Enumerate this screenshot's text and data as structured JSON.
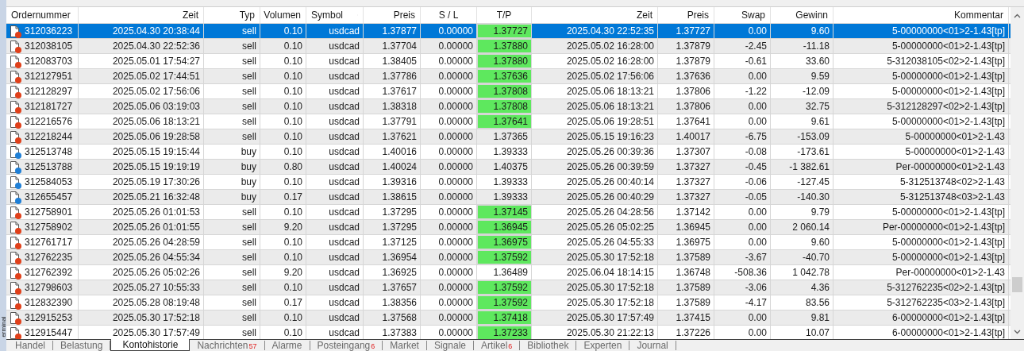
{
  "side_label": "erminal",
  "table": {
    "columns": [
      "Ordernummer",
      "Zeit",
      "Typ",
      "Volumen",
      "Symbol",
      "Preis",
      "S / L",
      "T/P",
      "Zeit",
      "Preis",
      "Swap",
      "Gewinn",
      "Kommentar"
    ],
    "rows": [
      {
        "selected": true,
        "tp_hit": true,
        "color": "#e0401a",
        "cells": [
          "312036223",
          "2025.04.30 20:38:44",
          "sell",
          "0.10",
          "usdcad",
          "1.37877",
          "0.00000",
          "1.37727",
          "2025.04.30 22:52:35",
          "1.37727",
          "0.00",
          "9.60",
          "5-00000000<01>2-1.43[tp]"
        ]
      },
      {
        "selected": false,
        "tp_hit": true,
        "color": "#e0401a",
        "cells": [
          "312038105",
          "2025.04.30 22:52:36",
          "sell",
          "0.10",
          "usdcad",
          "1.37704",
          "0.00000",
          "1.37880",
          "2025.05.02 16:28:00",
          "1.37879",
          "-2.45",
          "-11.18",
          "5-00000000<01>2-1.43[tp]"
        ]
      },
      {
        "selected": false,
        "tp_hit": true,
        "color": "#e0401a",
        "cells": [
          "312083703",
          "2025.05.01 17:54:27",
          "sell",
          "0.10",
          "usdcad",
          "1.38405",
          "0.00000",
          "1.37880",
          "2025.05.02 16:28:00",
          "1.37879",
          "-0.61",
          "33.60",
          "5-312038105<02>2-1.43[tp]"
        ]
      },
      {
        "selected": false,
        "tp_hit": true,
        "color": "#e0401a",
        "cells": [
          "312127951",
          "2025.05.02 17:44:51",
          "sell",
          "0.10",
          "usdcad",
          "1.37786",
          "0.00000",
          "1.37636",
          "2025.05.02 17:56:06",
          "1.37636",
          "0.00",
          "9.59",
          "5-00000000<01>2-1.43[tp]"
        ]
      },
      {
        "selected": false,
        "tp_hit": true,
        "color": "#e0401a",
        "cells": [
          "312128297",
          "2025.05.02 17:56:06",
          "sell",
          "0.10",
          "usdcad",
          "1.37617",
          "0.00000",
          "1.37808",
          "2025.05.06 18:13:21",
          "1.37806",
          "-1.22",
          "-12.09",
          "5-00000000<01>2-1.43[tp]"
        ]
      },
      {
        "selected": false,
        "tp_hit": true,
        "color": "#e0401a",
        "cells": [
          "312181727",
          "2025.05.06 03:19:03",
          "sell",
          "0.10",
          "usdcad",
          "1.38318",
          "0.00000",
          "1.37808",
          "2025.05.06 18:13:21",
          "1.37806",
          "0.00",
          "32.75",
          "5-312128297<02>2-1.43[tp]"
        ]
      },
      {
        "selected": false,
        "tp_hit": true,
        "color": "#e0401a",
        "cells": [
          "312216576",
          "2025.05.06 18:13:21",
          "sell",
          "0.10",
          "usdcad",
          "1.37791",
          "0.00000",
          "1.37641",
          "2025.05.06 19:28:51",
          "1.37641",
          "0.00",
          "9.61",
          "5-00000000<01>2-1.43[tp]"
        ]
      },
      {
        "selected": false,
        "tp_hit": false,
        "color": "#e0401a",
        "cells": [
          "312218244",
          "2025.05.06 19:28:58",
          "sell",
          "0.10",
          "usdcad",
          "1.37621",
          "0.00000",
          "1.37365",
          "2025.05.15 19:16:23",
          "1.40017",
          "-6.75",
          "-153.09",
          "5-00000000<01>2-1.43"
        ]
      },
      {
        "selected": false,
        "tp_hit": false,
        "color": "#1f7fd6",
        "cells": [
          "312513748",
          "2025.05.15 19:15:44",
          "buy",
          "0.10",
          "usdcad",
          "1.40016",
          "0.00000",
          "1.39333",
          "2025.05.26 00:39:36",
          "1.37307",
          "-0.08",
          "-173.61",
          "5-00000000<01>2-1.43"
        ]
      },
      {
        "selected": false,
        "tp_hit": false,
        "color": "#1f7fd6",
        "cells": [
          "312513788",
          "2025.05.15 19:19:19",
          "buy",
          "0.80",
          "usdcad",
          "1.40024",
          "0.00000",
          "1.40375",
          "2025.05.26 00:39:59",
          "1.37327",
          "-0.45",
          "-1 382.61",
          "Per-00000000<01>2-1.43"
        ]
      },
      {
        "selected": false,
        "tp_hit": false,
        "color": "#1f7fd6",
        "cells": [
          "312584053",
          "2025.05.19 17:30:26",
          "buy",
          "0.10",
          "usdcad",
          "1.39316",
          "0.00000",
          "1.39333",
          "2025.05.26 00:40:14",
          "1.37327",
          "-0.06",
          "-127.45",
          "5-312513748<02>2-1.43"
        ]
      },
      {
        "selected": false,
        "tp_hit": false,
        "color": "#1f7fd6",
        "cells": [
          "312655457",
          "2025.05.21 16:32:48",
          "buy",
          "0.17",
          "usdcad",
          "1.38615",
          "0.00000",
          "1.39333",
          "2025.05.26 00:40:29",
          "1.37327",
          "-0.05",
          "-140.30",
          "5-312513748<03>2-1.43"
        ]
      },
      {
        "selected": false,
        "tp_hit": true,
        "color": "#e0401a",
        "cells": [
          "312758901",
          "2025.05.26 01:01:53",
          "sell",
          "0.10",
          "usdcad",
          "1.37295",
          "0.00000",
          "1.37145",
          "2025.05.26 04:28:56",
          "1.37142",
          "0.00",
          "9.79",
          "5-00000000<01>2-1.43[tp]"
        ]
      },
      {
        "selected": false,
        "tp_hit": true,
        "color": "#e0401a",
        "cells": [
          "312758902",
          "2025.05.26 01:01:55",
          "sell",
          "9.20",
          "usdcad",
          "1.37295",
          "0.00000",
          "1.36945",
          "2025.05.26 05:02:25",
          "1.36945",
          "0.00",
          "2 060.14",
          "Per-00000000<01>2-1.43[tp]"
        ]
      },
      {
        "selected": false,
        "tp_hit": true,
        "color": "#e0401a",
        "cells": [
          "312761717",
          "2025.05.26 04:28:59",
          "sell",
          "0.10",
          "usdcad",
          "1.37125",
          "0.00000",
          "1.36975",
          "2025.05.26 04:55:33",
          "1.36975",
          "0.00",
          "9.60",
          "5-00000000<01>2-1.43[tp]"
        ]
      },
      {
        "selected": false,
        "tp_hit": true,
        "color": "#e0401a",
        "cells": [
          "312762235",
          "2025.05.26 04:55:34",
          "sell",
          "0.10",
          "usdcad",
          "1.36954",
          "0.00000",
          "1.37592",
          "2025.05.30 17:52:18",
          "1.37589",
          "-3.67",
          "-40.70",
          "5-00000000<01>2-1.43[tp]"
        ]
      },
      {
        "selected": false,
        "tp_hit": false,
        "color": "#e0401a",
        "cells": [
          "312762392",
          "2025.05.26 05:02:26",
          "sell",
          "9.20",
          "usdcad",
          "1.36925",
          "0.00000",
          "1.36489",
          "2025.06.04 18:14:15",
          "1.36748",
          "-508.36",
          "1 042.78",
          "Per-00000000<01>2-1.43"
        ]
      },
      {
        "selected": false,
        "tp_hit": true,
        "color": "#e0401a",
        "cells": [
          "312798603",
          "2025.05.27 10:55:33",
          "sell",
          "0.10",
          "usdcad",
          "1.37657",
          "0.00000",
          "1.37592",
          "2025.05.30 17:52:18",
          "1.37589",
          "-3.06",
          "4.36",
          "5-312762235<02>2-1.43[tp]"
        ]
      },
      {
        "selected": false,
        "tp_hit": true,
        "color": "#e0401a",
        "cells": [
          "312832390",
          "2025.05.28 08:19:48",
          "sell",
          "0.17",
          "usdcad",
          "1.38356",
          "0.00000",
          "1.37592",
          "2025.05.30 17:52:18",
          "1.37589",
          "-4.17",
          "83.56",
          "5-312762235<03>2-1.43[tp]"
        ]
      },
      {
        "selected": false,
        "tp_hit": true,
        "color": "#e0401a",
        "cells": [
          "312915253",
          "2025.05.30 17:52:18",
          "sell",
          "0.10",
          "usdcad",
          "1.37568",
          "0.00000",
          "1.37418",
          "2025.05.30 17:57:49",
          "1.37415",
          "0.00",
          "9.81",
          "6-00000000<01>2-1.43[tp]"
        ]
      },
      {
        "selected": false,
        "tp_hit": true,
        "color": "#e0401a",
        "cells": [
          "312915447",
          "2025.05.30 17:57:49",
          "sell",
          "0.10",
          "usdcad",
          "1.37383",
          "0.00000",
          "1.37233",
          "2025.05.30 21:22:13",
          "1.37226",
          "0.00",
          "10.07",
          "6-00000000<01>2-1.43[tp]"
        ]
      }
    ]
  },
  "tabs": [
    {
      "label": "Handel",
      "selected": false
    },
    {
      "label": "Belastung",
      "selected": false
    },
    {
      "label": "Kontohistorie",
      "selected": true
    },
    {
      "label": "Nachrichten",
      "badge": "57",
      "selected": false
    },
    {
      "label": "Alarme",
      "selected": false
    },
    {
      "label": "Posteingang",
      "badge": "6",
      "selected": false
    },
    {
      "label": "Market",
      "selected": false
    },
    {
      "label": "Signale",
      "selected": false
    },
    {
      "label": "Artikel",
      "badge": "6",
      "selected": false
    },
    {
      "label": "Bibliothek",
      "selected": false
    },
    {
      "label": "Experten",
      "selected": false
    },
    {
      "label": "Journal",
      "selected": false
    }
  ]
}
